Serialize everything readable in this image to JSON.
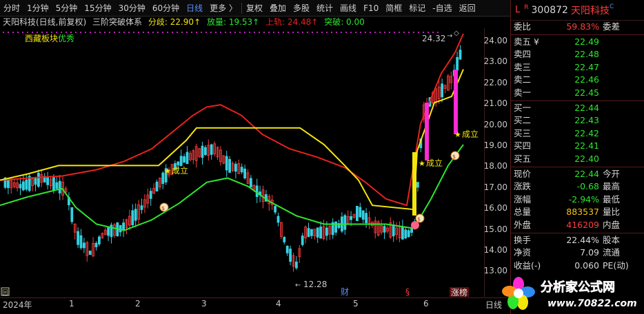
{
  "toolbar": {
    "items": [
      "分时",
      "1分钟",
      "5分钟",
      "15分钟",
      "30分钟",
      "60分钟",
      "日线",
      "更多 〉",
      "复权",
      "叠加",
      "多股",
      "统计",
      "画线",
      "F10",
      "简框",
      "标记",
      "-自选",
      "返回"
    ],
    "active": "日线"
  },
  "indicator": {
    "stock_label": "天阳科技(日线,前复权)",
    "system_name": "三阶突破体系",
    "fenqi": "分歧: 22.90↑",
    "fangliang": "放量: 19.53↑",
    "shanggui": "上轨: 24.48↑",
    "tupo": "突破: 0.00",
    "tag_block": "西藏板块",
    "tag_quality": "优秀"
  },
  "chart": {
    "annotation_high": "24.32",
    "annotation_low": "12.28",
    "chengli_1": "成立",
    "chengli_2": "成立",
    "chengli_3": "成立",
    "marker_cai": "财",
    "marker_s": "§",
    "marker_zhangbang": "涨榜",
    "marker_hui": "回",
    "price_ticks": [
      "24.00",
      "23.00",
      "22.00",
      "21.00",
      "20.00",
      "19.00",
      "18.00",
      "17.00",
      "16.00",
      "15.00",
      "14.00",
      "13.00"
    ],
    "time_labels": [
      "2024年",
      "1",
      "2",
      "3",
      "4",
      "5",
      "6"
    ],
    "time_corner": "日线"
  },
  "colors": {
    "red_line": "#e8221c",
    "yellow_line": "#f5e60a",
    "green_line": "#2ee62e",
    "up_candle": "#ff3c3c",
    "down_candle": "#35d0e0",
    "magenta": "#ff2ad4"
  },
  "panel": {
    "header_l": "L",
    "header_r": "R",
    "code": "300872",
    "name": "天阳科技",
    "header_c": "C",
    "weibi_label": "委比",
    "weibi_value": "59.83%",
    "weicha_label": "委差",
    "asks": [
      {
        "label": "卖五 ¥",
        "price": "22.49"
      },
      {
        "label": "卖四",
        "price": "22.48"
      },
      {
        "label": "卖三",
        "price": "22.47"
      },
      {
        "label": "卖二",
        "price": "22.46"
      },
      {
        "label": "卖一",
        "price": "22.45"
      }
    ],
    "bids": [
      {
        "label": "买一",
        "price": "22.44"
      },
      {
        "label": "买二",
        "price": "22.43"
      },
      {
        "label": "买三",
        "price": "22.42"
      },
      {
        "label": "买四",
        "price": "22.41"
      },
      {
        "label": "买五",
        "price": "22.40"
      }
    ],
    "stats": [
      {
        "label": "现价",
        "value": "22.44",
        "label2": "今开",
        "color": "#2ee62e"
      },
      {
        "label": "涨跌",
        "value": "-0.68",
        "label2": "最高",
        "color": "#2ee62e"
      },
      {
        "label": "涨幅",
        "value": "-2.94%",
        "label2": "最低",
        "color": "#2ee62e"
      },
      {
        "label": "总量",
        "value": "883537",
        "label2": "量比",
        "color": "#f5c518"
      },
      {
        "label": "外盘",
        "value": "416209",
        "label2": "内盘",
        "color": "#ff3c3c"
      }
    ],
    "stats2": [
      {
        "label": "换手",
        "value": "22.44%",
        "label2": "股本"
      },
      {
        "label": "净资",
        "value": "7.09",
        "label2": "流通"
      },
      {
        "label": "收益(-)",
        "value": "0.060",
        "label2": "PE(动)"
      }
    ]
  },
  "logo": {
    "title": "分析家公式网",
    "url": "www.70822.com"
  }
}
